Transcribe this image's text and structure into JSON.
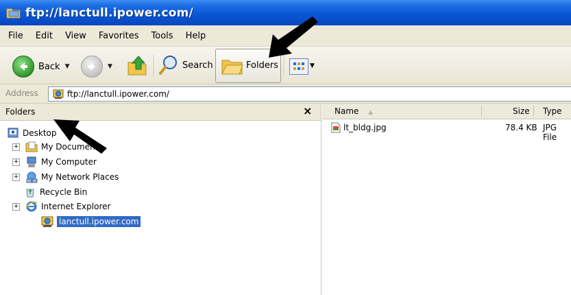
{
  "window": {
    "title": "ftp://lanctull.ipower.com/"
  },
  "menu": [
    "File",
    "Edit",
    "View",
    "Favorites",
    "Tools",
    "Help"
  ],
  "toolbar": {
    "back_label": "Back",
    "search_label": "Search",
    "folders_label": "Folders"
  },
  "address": {
    "label": "Address",
    "value": "ftp://lanctull.ipower.com/"
  },
  "folders_pane": {
    "title": "Folders",
    "close_glyph": "×",
    "tree": [
      {
        "label": "Desktop",
        "icon": "desktop-icon"
      },
      {
        "label": "My Documents",
        "icon": "my-documents-icon"
      },
      {
        "label": "My Computer",
        "icon": "my-computer-icon"
      },
      {
        "label": "My Network Places",
        "icon": "network-places-icon"
      },
      {
        "label": "Recycle Bin",
        "icon": "recycle-bin-icon"
      },
      {
        "label": "Internet Explorer",
        "icon": "internet-explorer-icon"
      },
      {
        "label": "lanctull.ipower.com",
        "icon": "ftp-folder-icon"
      }
    ]
  },
  "file_list": {
    "columns": {
      "name": "Name",
      "size": "Size",
      "type": "Type"
    },
    "rows": [
      {
        "name": "lt_bldg.jpg",
        "size": "78.4 KB",
        "type": "JPG File"
      }
    ]
  },
  "colors": {
    "titlebar": "#0a57d6",
    "selection": "#316ac5",
    "chrome": "#ece9d8"
  }
}
